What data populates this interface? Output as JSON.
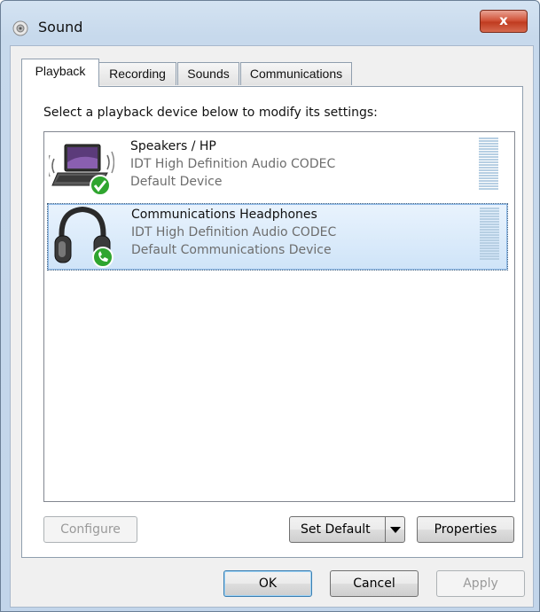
{
  "window": {
    "title": "Sound",
    "close_glyph": "x"
  },
  "tabs": [
    {
      "label": "Playback",
      "active": true
    },
    {
      "label": "Recording",
      "active": false
    },
    {
      "label": "Sounds",
      "active": false
    },
    {
      "label": "Communications",
      "active": false
    }
  ],
  "playback": {
    "instruction": "Select a playback device below to modify its settings:",
    "devices": [
      {
        "name": "Speakers / HP",
        "driver": "IDT High Definition Audio CODEC",
        "status": "Default Device",
        "icon": "laptop-speakers-icon",
        "badge": "green-check-icon",
        "selected": false
      },
      {
        "name": "Communications Headphones",
        "driver": "IDT High Definition Audio CODEC",
        "status": "Default Communications Device",
        "icon": "headphones-icon",
        "badge": "green-phone-icon",
        "selected": true
      }
    ],
    "configure_label": "Configure",
    "set_default_label": "Set Default",
    "properties_label": "Properties"
  },
  "footer": {
    "ok_label": "OK",
    "cancel_label": "Cancel",
    "apply_label": "Apply"
  },
  "colors": {
    "accent_selection": "#cfe4f8",
    "badge_green": "#2fa52f",
    "close_red": "#c03b20"
  }
}
